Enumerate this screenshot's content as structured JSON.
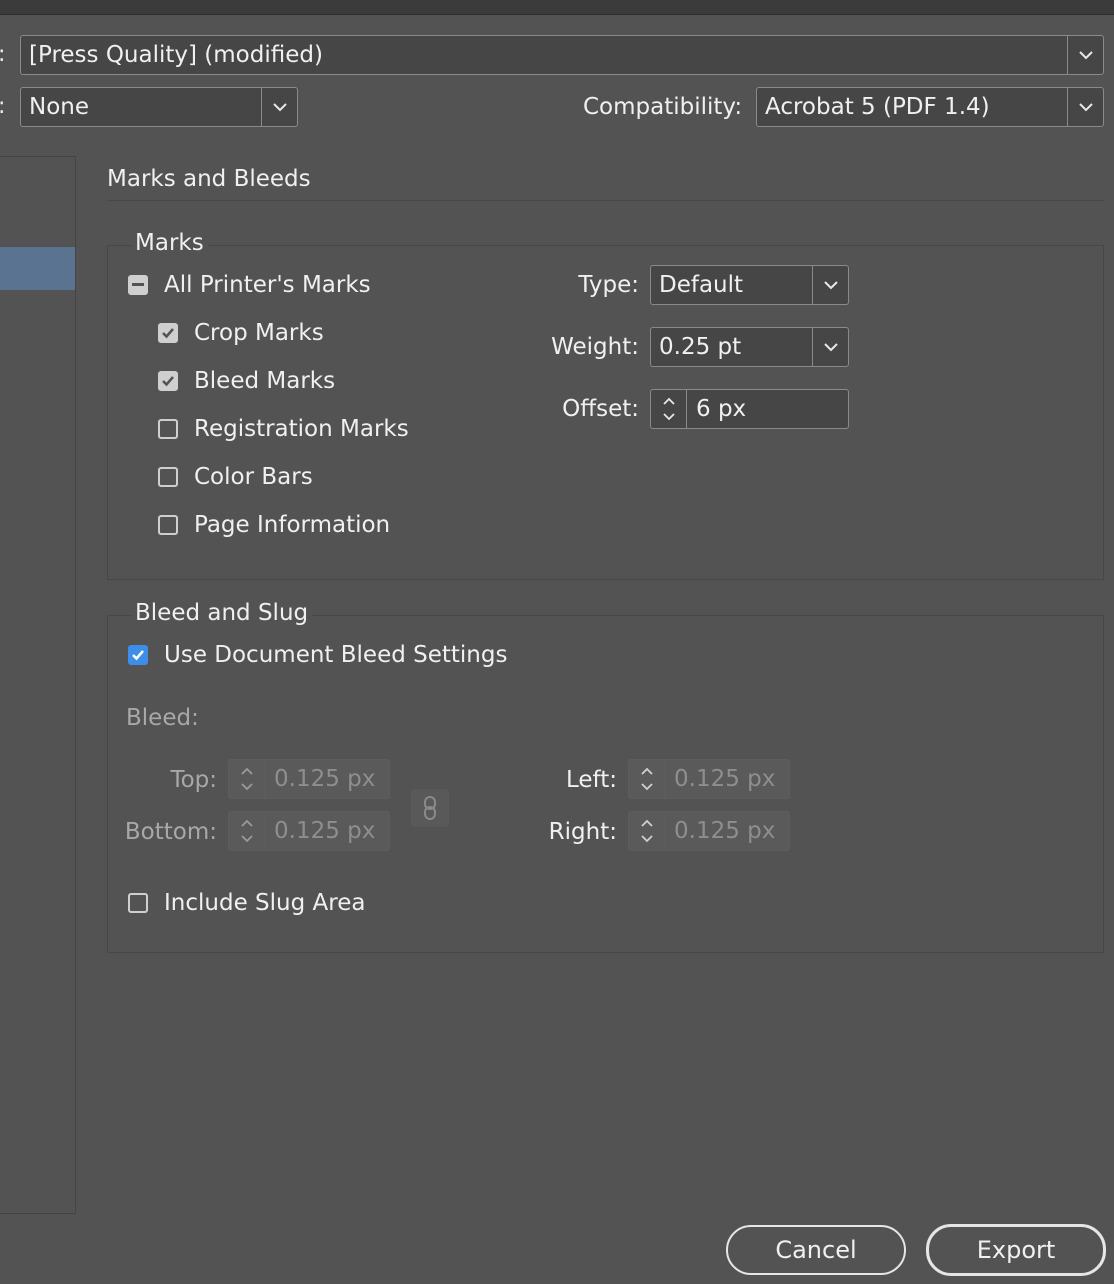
{
  "header": {
    "preset_value": "[Press Quality] (modified)",
    "standard_value": "None",
    "compatibility_label": "Compatibility:",
    "compatibility_value": "Acrobat 5 (PDF 1.4)"
  },
  "section": {
    "title": "Marks and Bleeds"
  },
  "marks": {
    "legend": "Marks",
    "all_printers_marks": "All Printer's Marks",
    "items": [
      {
        "label": "Crop Marks",
        "checked": true
      },
      {
        "label": "Bleed Marks",
        "checked": true
      },
      {
        "label": "Registration Marks",
        "checked": false
      },
      {
        "label": "Color Bars",
        "checked": false
      },
      {
        "label": "Page Information",
        "checked": false
      }
    ],
    "type_label": "Type:",
    "type_value": "Default",
    "weight_label": "Weight:",
    "weight_value": "0.25 pt",
    "offset_label": "Offset:",
    "offset_value": "6 px"
  },
  "bleed_slug": {
    "legend": "Bleed and Slug",
    "use_doc_bleed": "Use Document Bleed Settings",
    "bleed_label": "Bleed:",
    "top_label": "Top:",
    "top_value": "0.125 px",
    "bottom_label": "Bottom:",
    "bottom_value": "0.125 px",
    "left_label": "Left:",
    "left_value": "0.125 px",
    "right_label": "Right:",
    "right_value": "0.125 px",
    "include_slug": "Include Slug Area"
  },
  "footer": {
    "cancel": "Cancel",
    "export": "Export"
  },
  "colors": {
    "background": "#535353",
    "accent": "#3d8ee9",
    "sidebar_selected": "#5a7391"
  },
  "icons": [
    "chevron-down-icon",
    "stepper-arrows-icon",
    "link-icon",
    "checkmark-icon",
    "minus-icon"
  ]
}
